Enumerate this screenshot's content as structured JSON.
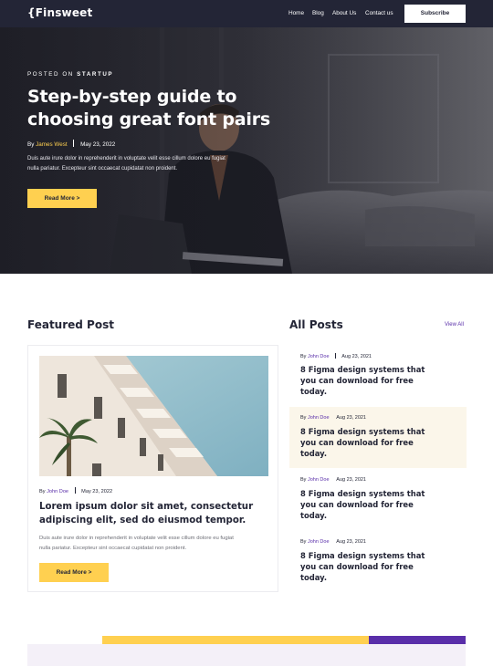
{
  "nav": {
    "logo": "{Finsweet",
    "links": [
      "Home",
      "Blog",
      "About Us",
      "Contact us"
    ],
    "subscribe": "Subscribe"
  },
  "hero": {
    "posted_prefix": "POSTED ON",
    "posted_category": "STARTUP",
    "title": "Step-by-step guide to choosing great font pairs",
    "by": "By",
    "author": "James West",
    "date": "May 23, 2022",
    "description": "Duis aute irure dolor in reprehenderit in voluptate velit esse cillum dolore eu fugiat nulla pariatur. Excepteur sint occaecat cupidatat non proident.",
    "button": "Read More >"
  },
  "featured": {
    "heading": "Featured Post",
    "by": "By",
    "author": "John Doe",
    "date": "May 23, 2022",
    "title": "Lorem ipsum dolor sit amet, consectetur adipiscing elit, sed do eiusmod tempor.",
    "description": "Duis aute irure dolor in reprehenderit in voluptate velit esse cillum dolore eu fugiat nulla pariatur. Excepteur sint occaecat cupidatat non proident.",
    "button": "Read More >"
  },
  "all_posts": {
    "heading": "All Posts",
    "view_all": "View All",
    "items": [
      {
        "by": "By",
        "author": "John Doe",
        "date": "Aug 23, 2021",
        "title": "8 Figma design systems that you can download for free today."
      },
      {
        "by": "By",
        "author": "John Doe",
        "date": "Aug 23, 2021",
        "title": "8 Figma design systems that you can download for free today."
      },
      {
        "by": "By",
        "author": "John Doe",
        "date": "Aug 23, 2021",
        "title": "8 Figma design systems that you can download for free today."
      },
      {
        "by": "By",
        "author": "John Doe",
        "date": "Aug 23, 2021",
        "title": "8 Figma design systems that you can download for free today."
      }
    ]
  },
  "colors": {
    "dark": "#232536",
    "accent_yellow": "#FFD050",
    "accent_purple": "#592EA9",
    "highlight": "#FBF6EA"
  }
}
